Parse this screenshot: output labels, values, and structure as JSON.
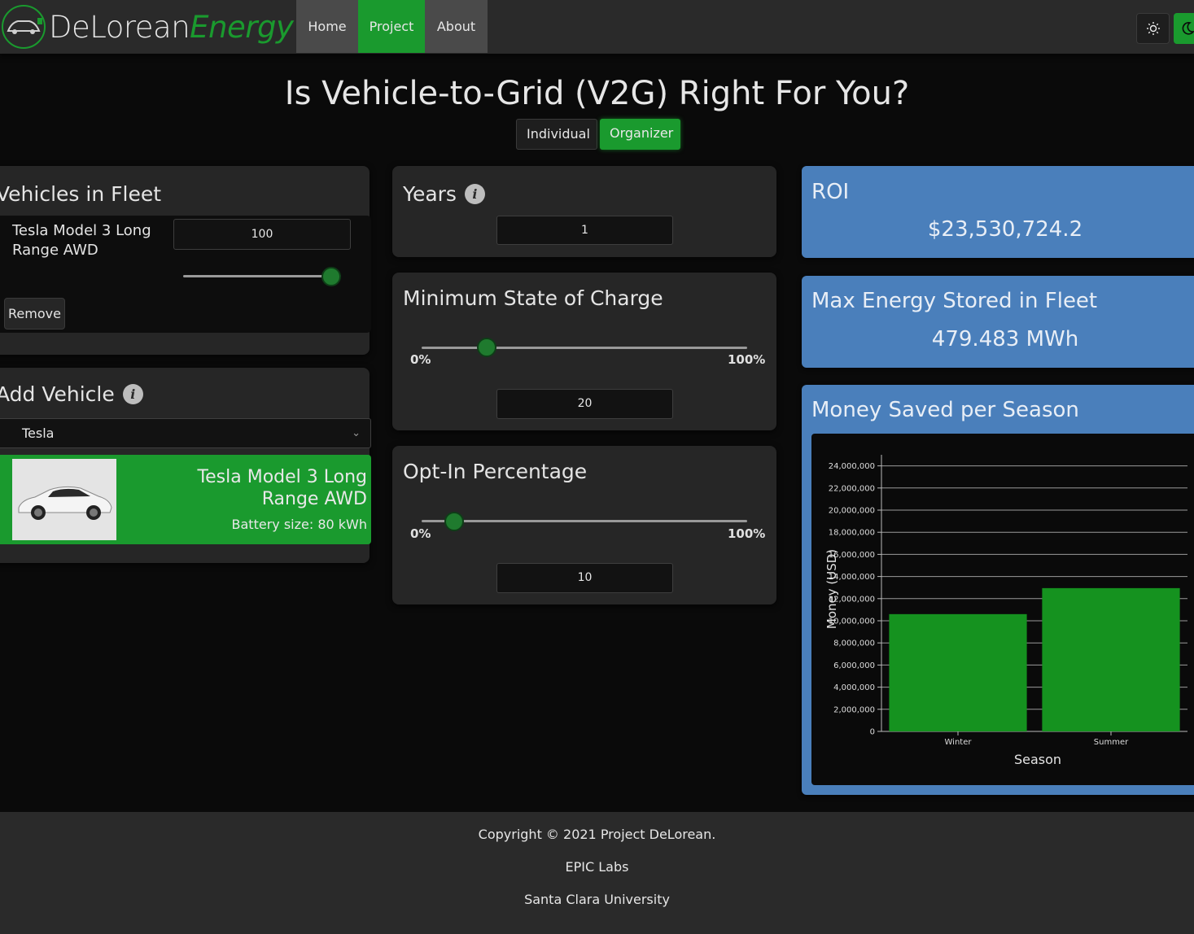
{
  "nav": {
    "logo_primary": "DeLorean",
    "logo_secondary": "Energy",
    "items": [
      {
        "label": "Home"
      },
      {
        "label": "Project"
      },
      {
        "label": "About"
      }
    ],
    "active": "Project",
    "theme_light_icon": "sun-icon",
    "theme_dark_icon": "moon-icon"
  },
  "page": {
    "title": "Is Vehicle-to-Grid (V2G) Right For You?",
    "modes": [
      "Individual",
      "Organizer"
    ],
    "selected_mode": "Organizer"
  },
  "fleet": {
    "title": "Vehicles in Fleet",
    "vehicles": [
      {
        "name": "Tesla Model 3 Long Range AWD",
        "count": "100",
        "slider_fraction": 1.0
      }
    ],
    "remove_label": "Remove"
  },
  "add_vehicle": {
    "title": "Add Vehicle",
    "make_selected": "Tesla",
    "option": {
      "name": "Tesla Model 3 Long Range AWD",
      "battery": "Battery size: 80 kWh"
    }
  },
  "years": {
    "title": "Years",
    "value": "1"
  },
  "min_soc": {
    "title": "Minimum State of Charge",
    "min_label": "0%",
    "max_label": "100%",
    "value": "20",
    "percent": 20
  },
  "opt_in": {
    "title": "Opt-In Percentage",
    "min_label": "0%",
    "max_label": "100%",
    "value": "10",
    "percent": 10
  },
  "roi": {
    "title": "ROI",
    "value": "$23,530,724.2"
  },
  "energy": {
    "title": "Max Energy Stored in Fleet",
    "value": "479.483 MWh"
  },
  "savings": {
    "title": "Money Saved per Season"
  },
  "chart_data": {
    "type": "bar",
    "categories": [
      "Winter",
      "Summer"
    ],
    "values": [
      10600000,
      12950000
    ],
    "xlabel": "Season",
    "ylabel": "Money (USD)",
    "ylim": [
      0,
      25000000
    ],
    "yticks": [
      "0",
      "2,000,000",
      "4,000,000",
      "6,000,000",
      "8,000,000",
      "10,000,000",
      "12,000,000",
      "14,000,000",
      "16,000,000",
      "18,000,000",
      "20,000,000",
      "22,000,000",
      "24,000,000"
    ],
    "ytick_values": [
      0,
      2000000,
      4000000,
      6000000,
      8000000,
      10000000,
      12000000,
      14000000,
      16000000,
      18000000,
      20000000,
      22000000,
      24000000
    ],
    "grid": true,
    "bar_color": "#15921f"
  },
  "footer": {
    "copyright": "Copyright © 2021 Project DeLorean.",
    "lab": "EPIC Labs",
    "university": "Santa Clara University"
  },
  "colors": {
    "accent": "#1a9a2e",
    "info_card": "#4a7fbb",
    "background": "#0a0a0a"
  }
}
